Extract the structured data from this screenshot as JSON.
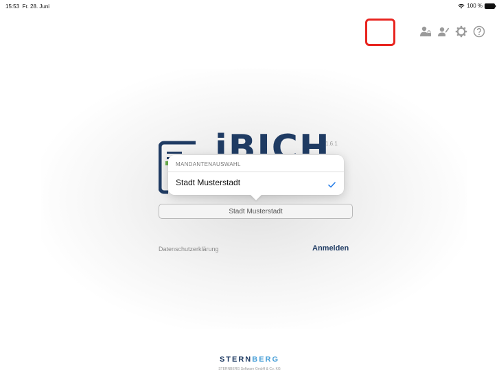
{
  "status_bar": {
    "time": "15:53",
    "date": "Fr. 28. Juni",
    "battery": "100 %",
    "wifi_icon": "wifi-icon",
    "battery_icon": "battery-icon"
  },
  "toolbar": {
    "icons": [
      "user-lock-icon",
      "user-edit-icon",
      "gear-icon",
      "help-icon"
    ]
  },
  "logo": {
    "text": "iBICH",
    "version": "1.6.1",
    "color": "#1f3b63",
    "accent_color": "#4aa0d8"
  },
  "popover": {
    "header": "MANDANTENAUSWAHL",
    "options": [
      {
        "label": "Stadt Musterstadt",
        "selected": true
      }
    ],
    "check_color": "#2a7fe8"
  },
  "select": {
    "value": "Stadt Musterstadt"
  },
  "links": {
    "privacy": "Datenschutzerklärung",
    "login": "Anmelden"
  },
  "footer": {
    "brand_part1": "STERN",
    "brand_part2": "BERG",
    "company": "STERNBERG Software GmbH & Co. KG"
  },
  "colors": {
    "highlight": "#e8241f",
    "icon_gray": "#9a9a9a"
  }
}
